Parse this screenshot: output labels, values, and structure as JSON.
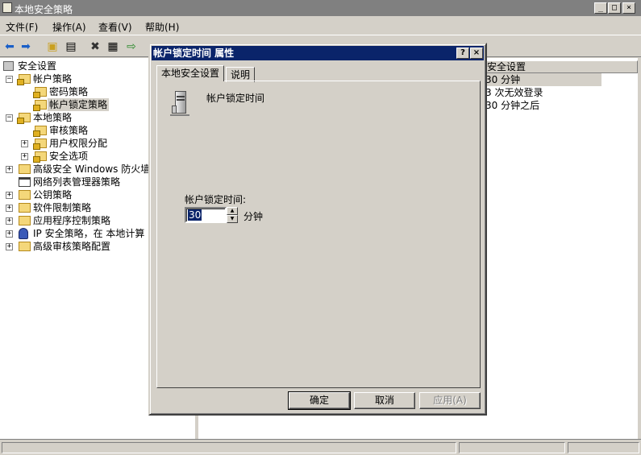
{
  "window": {
    "title": "本地安全策略",
    "min": "_",
    "max": "□",
    "close": "×"
  },
  "menu": [
    "文件(F)",
    "操作(A)",
    "查看(V)",
    "帮助(H)"
  ],
  "tree": {
    "root": "安全设置",
    "account_policy": "帐户策略",
    "password_policy": "密码策略",
    "lockout_policy": "帐户锁定策略",
    "local_policy": "本地策略",
    "audit_policy": "审核策略",
    "user_rights": "用户权限分配",
    "security_options": "安全选项",
    "firewall": "高级安全 Windows 防火墙",
    "network_list": "网络列表管理器策略",
    "public_key": "公钥策略",
    "software_restriction": "软件限制策略",
    "app_control": "应用程序控制策略",
    "ip_security": "IP 安全策略，在 本地计算",
    "advanced_audit": "高级审核策略配置"
  },
  "list": {
    "header": "安全设置",
    "rows": [
      "30 分钟",
      "3 次无效登录",
      "30 分钟之后"
    ]
  },
  "dialog": {
    "title": "帐户锁定时间 属性",
    "help": "?",
    "close": "×",
    "tabs": [
      "本地安全设置",
      "说明"
    ],
    "policy_name": "帐户锁定时间",
    "field_label": "帐户锁定时间:",
    "value": "30",
    "unit": "分钟",
    "ok": "确定",
    "cancel": "取消",
    "apply": "应用(A)"
  },
  "colors": {
    "title_active": "#0a246a",
    "title_inactive": "#808080",
    "face": "#d4d0c8"
  }
}
